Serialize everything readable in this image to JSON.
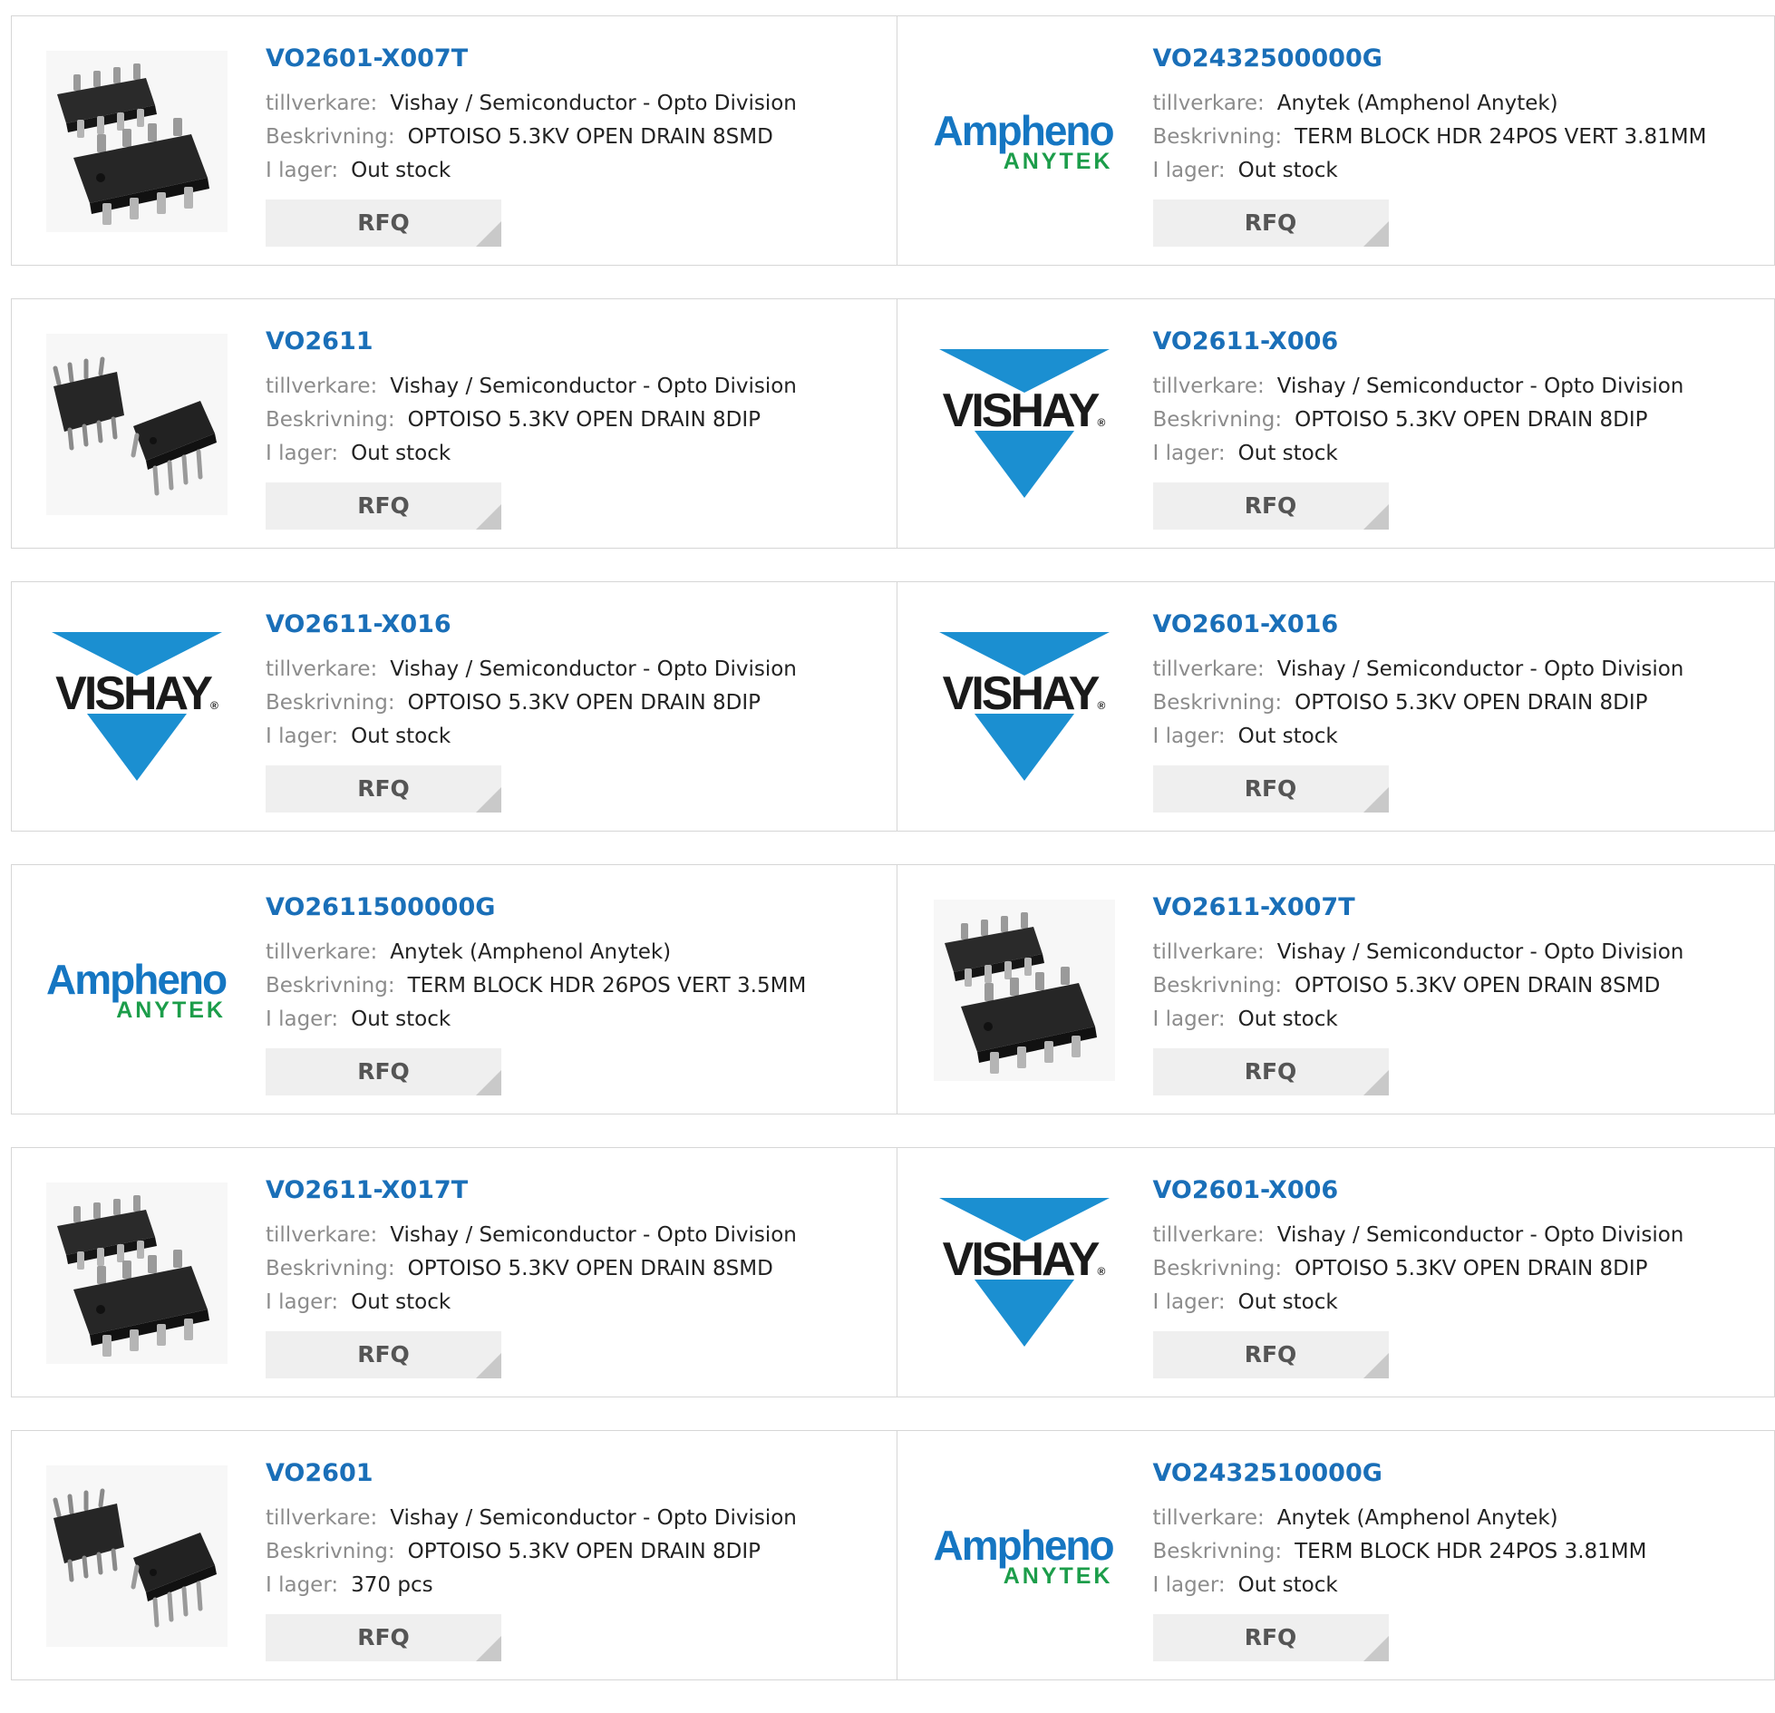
{
  "labels": {
    "manufacturer": "tillverkare:",
    "description": "Beskrivning:",
    "stock": "I lager:",
    "rfq": "RFQ"
  },
  "logos": {
    "amphenol_main": "Amphenol",
    "amphenol_sub": "ANYTEK",
    "vishay": "VISHAY"
  },
  "colors": {
    "link": "#1a6fb8",
    "amphenol_blue": "#1576c2",
    "amphenol_green": "#1c9d4a",
    "vishay_blue": "#1b8fd1"
  },
  "products": [
    {
      "pn": "VO2601-X007T",
      "manufacturer": "Vishay / Semiconductor - Opto Division",
      "description": "OPTOISO 5.3KV OPEN DRAIN 8SMD",
      "stock": "Out stock",
      "image": "smd-chip"
    },
    {
      "pn": "VO2432500000G",
      "manufacturer": "Anytek (Amphenol Anytek)",
      "description": "TERM BLOCK HDR 24POS VERT 3.81MM",
      "stock": "Out stock",
      "image": "amphenol-logo"
    },
    {
      "pn": "VO2611",
      "manufacturer": "Vishay / Semiconductor - Opto Division",
      "description": "OPTOISO 5.3KV OPEN DRAIN 8DIP",
      "stock": "Out stock",
      "image": "dip-chip"
    },
    {
      "pn": "VO2611-X006",
      "manufacturer": "Vishay / Semiconductor - Opto Division",
      "description": "OPTOISO 5.3KV OPEN DRAIN 8DIP",
      "stock": "Out stock",
      "image": "vishay-logo"
    },
    {
      "pn": "VO2611-X016",
      "manufacturer": "Vishay / Semiconductor - Opto Division",
      "description": "OPTOISO 5.3KV OPEN DRAIN 8DIP",
      "stock": "Out stock",
      "image": "vishay-logo"
    },
    {
      "pn": "VO2601-X016",
      "manufacturer": "Vishay / Semiconductor - Opto Division",
      "description": "OPTOISO 5.3KV OPEN DRAIN 8DIP",
      "stock": "Out stock",
      "image": "vishay-logo"
    },
    {
      "pn": "VO2611500000G",
      "manufacturer": "Anytek (Amphenol Anytek)",
      "description": "TERM BLOCK HDR 26POS VERT 3.5MM",
      "stock": "Out stock",
      "image": "amphenol-logo"
    },
    {
      "pn": "VO2611-X007T",
      "manufacturer": "Vishay / Semiconductor - Opto Division",
      "description": "OPTOISO 5.3KV OPEN DRAIN 8SMD",
      "stock": "Out stock",
      "image": "smd-chip"
    },
    {
      "pn": "VO2611-X017T",
      "manufacturer": "Vishay / Semiconductor - Opto Division",
      "description": "OPTOISO 5.3KV OPEN DRAIN 8SMD",
      "stock": "Out stock",
      "image": "smd-chip"
    },
    {
      "pn": "VO2601-X006",
      "manufacturer": "Vishay / Semiconductor - Opto Division",
      "description": "OPTOISO 5.3KV OPEN DRAIN 8DIP",
      "stock": "Out stock",
      "image": "vishay-logo"
    },
    {
      "pn": "VO2601",
      "manufacturer": "Vishay / Semiconductor - Opto Division",
      "description": "OPTOISO 5.3KV OPEN DRAIN 8DIP",
      "stock": "370 pcs",
      "image": "dip-chip"
    },
    {
      "pn": "VO2432510000G",
      "manufacturer": "Anytek (Amphenol Anytek)",
      "description": "TERM BLOCK HDR 24POS 3.81MM",
      "stock": "Out stock",
      "image": "amphenol-logo"
    }
  ]
}
